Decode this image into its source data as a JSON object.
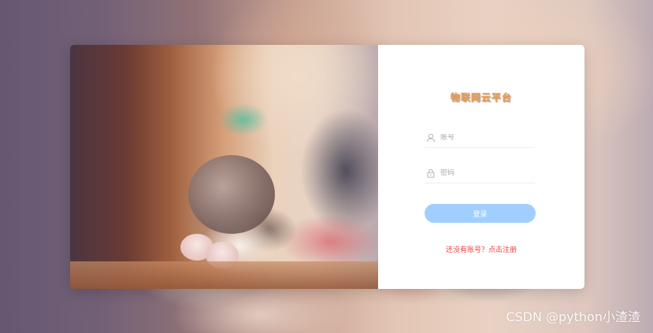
{
  "form": {
    "title": "物联网云平台",
    "account_placeholder": "账号",
    "password_placeholder": "密码",
    "login_label": "登录",
    "register_link": "还没有账号？点击注册"
  },
  "icons": {
    "account": "user-icon",
    "password": "lock-icon"
  },
  "colors": {
    "title": "#e6a05a",
    "login_button": "#a0cfff",
    "register_link": "#f04040"
  },
  "watermark": "CSDN @python小渣渣"
}
